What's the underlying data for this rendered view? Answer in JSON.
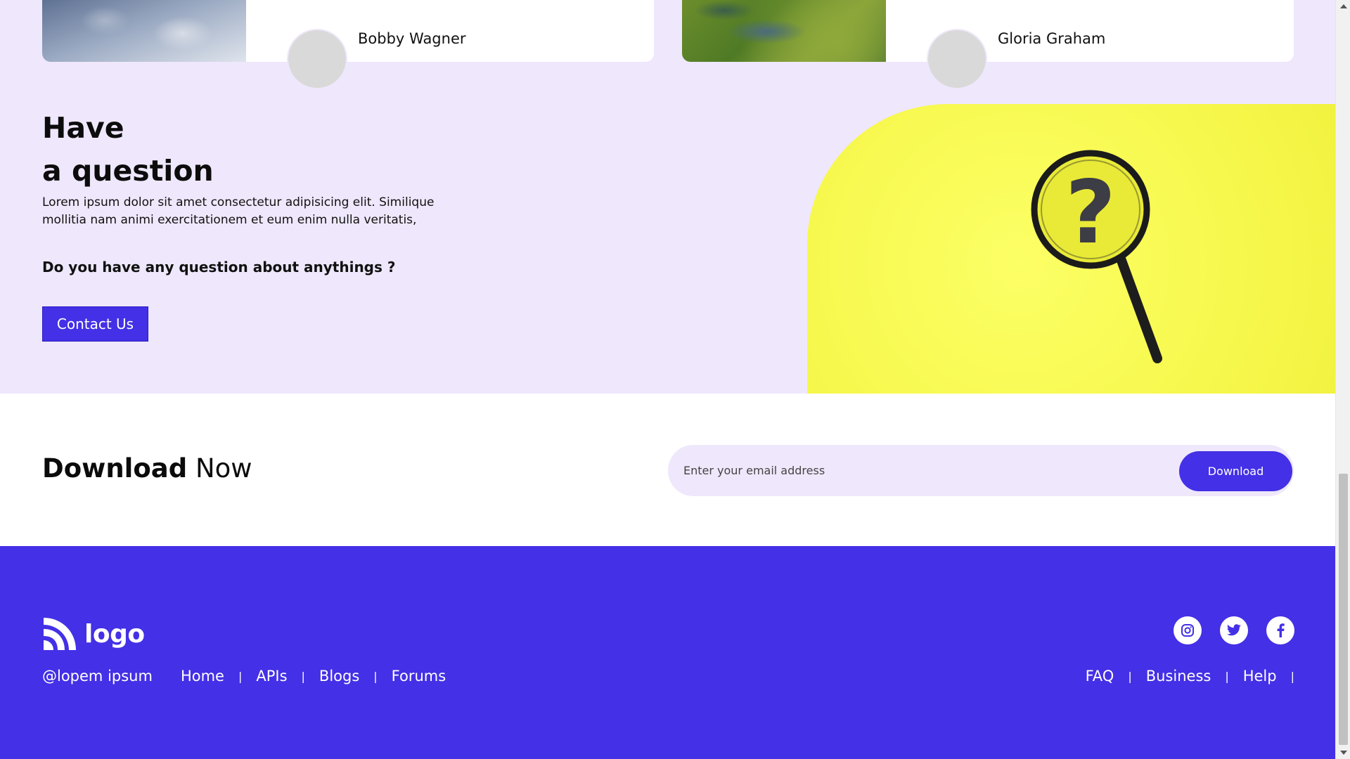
{
  "cards": [
    {
      "name": "Bobby Wagner",
      "image": "office-desk-photo"
    },
    {
      "name": "Gloria Graham",
      "image": "aerial-forest-river-photo"
    }
  ],
  "question": {
    "title_line1": "Have",
    "title_line2": "a question",
    "text": "Lorem ipsum dolor sit amet consectetur adipisicing elit. Similique mollitia nam animi exercitationem et eum enim nulla veritatis,",
    "ask": "Do you have any question about anythings ?",
    "button": "Contact Us",
    "image": "magnifier-question-mark-photo"
  },
  "download": {
    "title_bold": "Download",
    "title_light": "Now",
    "email_placeholder": "Enter your email address",
    "button": "Download"
  },
  "footer": {
    "logo_text": "logo",
    "handle": "@lopem ipsum",
    "left_links": [
      "Home",
      "APIs",
      "Blogs",
      "Forums"
    ],
    "right_links": [
      "FAQ",
      "Business",
      "Help"
    ],
    "separator": "|",
    "social": [
      "instagram-icon",
      "twitter-icon",
      "facebook-icon"
    ]
  },
  "colors": {
    "brand": "#4430e6",
    "lavender": "#efe7fb",
    "yellow": "#f7f84e"
  }
}
